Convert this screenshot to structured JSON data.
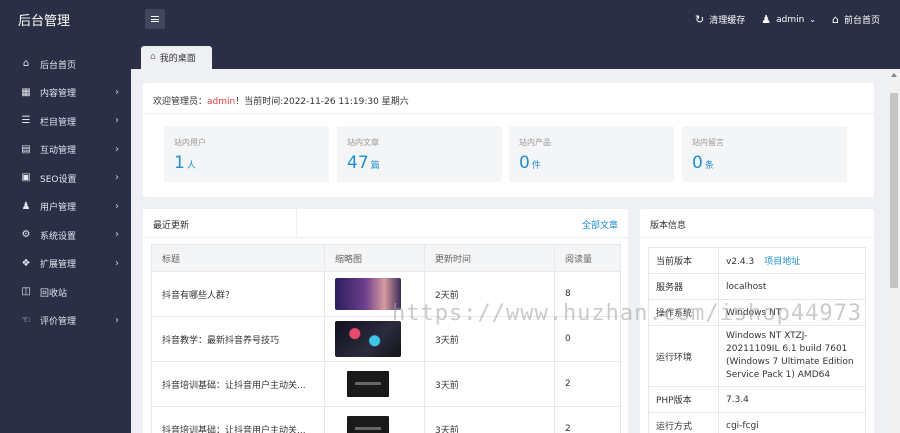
{
  "brand": "后台管理",
  "topbar": {
    "clear_cache": "清理缓存",
    "user": "admin",
    "home": "前台首页"
  },
  "sidebar": {
    "items": [
      {
        "label": "后台首页",
        "icon": "home-icon",
        "chevron": false
      },
      {
        "label": "内容管理",
        "icon": "grid-icon",
        "chevron": true
      },
      {
        "label": "栏目管理",
        "icon": "list-icon",
        "chevron": true
      },
      {
        "label": "互动管理",
        "icon": "chat-icon",
        "chevron": true
      },
      {
        "label": "SEO设置",
        "icon": "seo-icon",
        "chevron": true
      },
      {
        "label": "用户管理",
        "icon": "user-icon",
        "chevron": true
      },
      {
        "label": "系统设置",
        "icon": "gear-icon",
        "chevron": true
      },
      {
        "label": "扩展管理",
        "icon": "puzzle-icon",
        "chevron": true
      },
      {
        "label": "回收站",
        "icon": "trash-icon",
        "chevron": false
      },
      {
        "label": "评价管理",
        "icon": "thumbs-up-icon",
        "chevron": true
      }
    ]
  },
  "tab": {
    "label": "我的桌面"
  },
  "welcome": {
    "prefix": "欢迎管理员：",
    "admin": "admin",
    "suffix": "！当前时间:2022-11-26 11:19:30 星期六"
  },
  "stats": [
    {
      "label": "站内用户",
      "value": "1",
      "unit": "人"
    },
    {
      "label": "站内文章",
      "value": "47",
      "unit": "篇"
    },
    {
      "label": "站内产品",
      "value": "0",
      "unit": "件"
    },
    {
      "label": "站内留言",
      "value": "0",
      "unit": "条"
    }
  ],
  "news": {
    "title": "最近更新",
    "more": "全部文章",
    "columns": [
      "标题",
      "缩略图",
      "更新时间",
      "阅读量"
    ],
    "rows": [
      {
        "title": "抖音有哪些人群？",
        "time": "2天前",
        "views": "8"
      },
      {
        "title": "抖音教学：最新抖音养号技巧",
        "time": "3天前",
        "views": "0"
      },
      {
        "title": "抖音培训基础：让抖音用户主动关...",
        "time": "3天前",
        "views": "2"
      },
      {
        "title": "抖音培训基础：让抖音用户主动关...",
        "time": "3天前",
        "views": "2"
      }
    ]
  },
  "version": {
    "title": "版本信息",
    "rows": [
      {
        "k": "当前版本",
        "v": "v2.4.3",
        "link": "项目地址"
      },
      {
        "k": "服务器",
        "v": "localhost"
      },
      {
        "k": "操作系统",
        "v": "Windows NT"
      },
      {
        "k": "运行环境",
        "v": "Windows NT XTZJ-20211109IL 6.1 build 7601 (Windows 7 Ultimate Edition Service Pack 1) AMD64"
      },
      {
        "k": "PHP版本",
        "v": "7.3.4"
      },
      {
        "k": "运行方式",
        "v": "cgi-fcgi"
      }
    ]
  },
  "watermark": "https://www.huzhan.com/ishop44973",
  "colors": {
    "sidebar": "#2a2f45",
    "accent": "#1f8ed0",
    "admin_red": "#e23b3b"
  }
}
